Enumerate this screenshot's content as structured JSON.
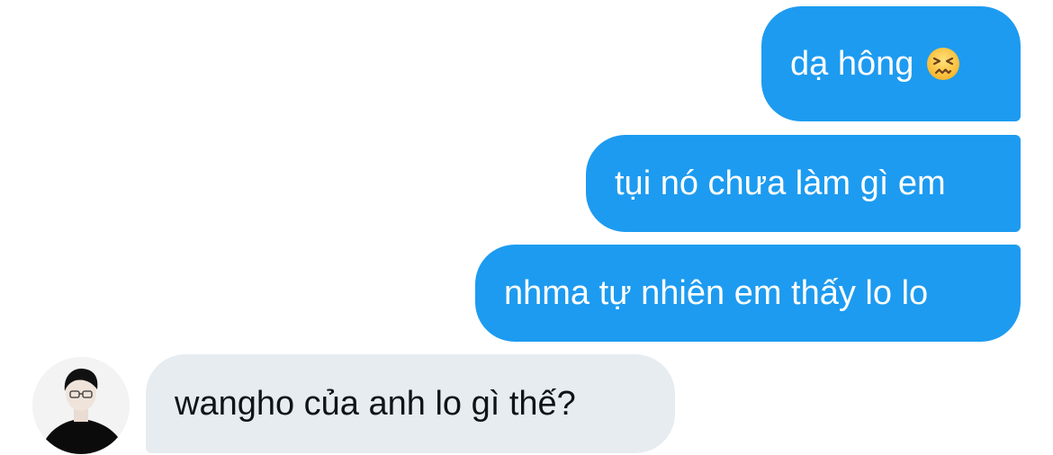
{
  "messages": [
    {
      "direction": "outgoing",
      "text": "dạ hông",
      "emoji": "confounded-face"
    },
    {
      "direction": "outgoing",
      "text": "tụi nó chưa làm gì em"
    },
    {
      "direction": "outgoing",
      "text": "nhma tự nhiên em thấy lo lo"
    },
    {
      "direction": "incoming",
      "text": "wangho của anh lo gì thế?"
    }
  ],
  "colors": {
    "outgoing_bubble": "#1d9bf0",
    "incoming_bubble": "#e7ecf0",
    "outgoing_text": "#ffffff",
    "incoming_text": "#0f1419"
  }
}
